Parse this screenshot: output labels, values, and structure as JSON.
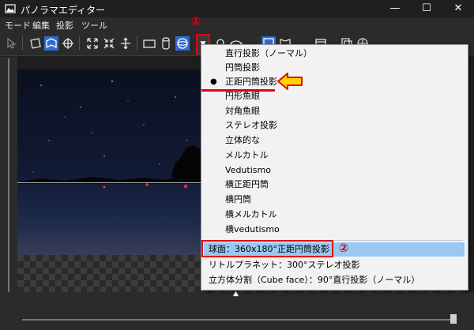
{
  "window": {
    "title": "パノラマエディター",
    "controls": {
      "minimize": "—",
      "maximize": "☐",
      "close": "✕"
    }
  },
  "menu": {
    "items": [
      "モード",
      "編集",
      "投影",
      "ツール"
    ]
  },
  "toolbar": {
    "dropdown_arrow": "▼",
    "icons": [
      "select-icon",
      "rectilinear-icon",
      "mosaic-icon",
      "crosshair-icon",
      "fit-icon",
      "compress-icon",
      "move-icon",
      "rectangle-icon",
      "cylinder-icon",
      "sphere-icon",
      "dropdown-arrow-icon",
      "lens-icon",
      "eye-icon",
      "frame-icon",
      "book-icon",
      "window-icon",
      "layers-icon",
      "globe-icon"
    ],
    "active_icons": [
      "rectilinear-icon",
      "sphere-icon",
      "frame-icon"
    ]
  },
  "annotations": {
    "marker1": "①",
    "marker2": "②",
    "accent_color": "#e60012",
    "arrow_color": "#ffd400"
  },
  "projection_menu": {
    "items": [
      {
        "label": "直行投影（ノーマル）",
        "selected": false,
        "highlighted": false
      },
      {
        "label": "円筒投影",
        "selected": false,
        "highlighted": false
      },
      {
        "label": "正距円筒投影",
        "selected": true,
        "highlighted": false
      },
      {
        "label": "円形魚眼",
        "selected": false,
        "highlighted": false
      },
      {
        "label": "対角魚眼",
        "selected": false,
        "highlighted": false
      },
      {
        "label": "ステレオ投影",
        "selected": false,
        "highlighted": false
      },
      {
        "label": "立体的な",
        "selected": false,
        "highlighted": false
      },
      {
        "label": "メルカトル",
        "selected": false,
        "highlighted": false
      },
      {
        "label": "Vedutismo",
        "selected": false,
        "highlighted": false
      },
      {
        "label": "横正距円筒",
        "selected": false,
        "highlighted": false
      },
      {
        "label": "横円筒",
        "selected": false,
        "highlighted": false
      },
      {
        "label": "横メルカトル",
        "selected": false,
        "highlighted": false
      },
      {
        "label": "横vedutismo",
        "selected": false,
        "highlighted": false
      }
    ],
    "presets": [
      {
        "label": "球面：360x180°正距円筒投影",
        "highlighted": true
      },
      {
        "label": "リトルプラネット：300°ステレオ投影",
        "highlighted": false
      },
      {
        "label": "立方体分割（Cube face）：90°直行投影（ノーマル）",
        "highlighted": false
      }
    ],
    "highlight_color": "#99c8f2"
  },
  "viewport": {
    "collapse_marker": "▲"
  }
}
